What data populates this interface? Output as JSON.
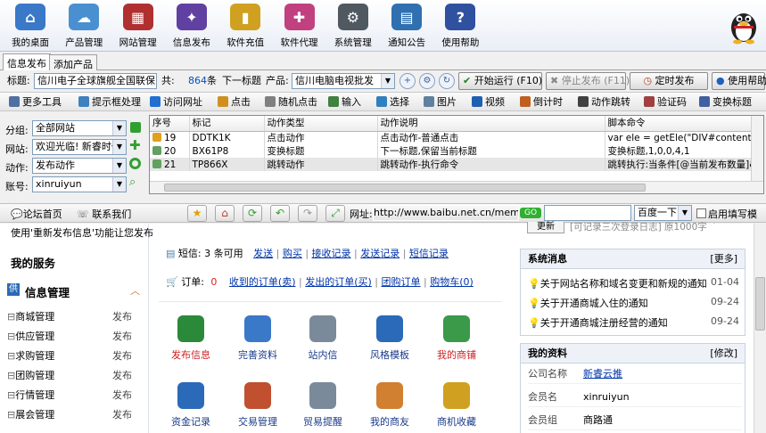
{
  "toolbar": {
    "buttons": [
      {
        "label": "我的桌面",
        "icon": "home-icon",
        "color": "#3a78c8",
        "glyph": "⌂"
      },
      {
        "label": "产品管理",
        "icon": "cloud-icon",
        "color": "#4a90d0",
        "glyph": "☁"
      },
      {
        "label": "网站管理",
        "icon": "building-icon",
        "color": "#b03030",
        "glyph": "▦"
      },
      {
        "label": "信息发布",
        "icon": "magic-wand-icon",
        "color": "#6040a0",
        "glyph": "✦"
      },
      {
        "label": "软件充值",
        "icon": "chart-icon",
        "color": "#d0a020",
        "glyph": "▮"
      },
      {
        "label": "软件代理",
        "icon": "gift-icon",
        "color": "#c04080",
        "glyph": "✚"
      },
      {
        "label": "系统管理",
        "icon": "gear-icon",
        "color": "#505860",
        "glyph": "⚙"
      },
      {
        "label": "通知公告",
        "icon": "notebook-icon",
        "color": "#3070b0",
        "glyph": "▤"
      },
      {
        "label": "使用帮助",
        "icon": "help-icon",
        "color": "#3050a0",
        "glyph": "?"
      }
    ]
  },
  "tabs": [
    "信息发布",
    "添加产品"
  ],
  "title_row": {
    "title_label": "标题:",
    "title_value": "信川电子全球旗舰全国联保",
    "total_label": "共:",
    "total_count": "864",
    "total_unit": "条",
    "next_title": "下一标题",
    "product_label": "产品:",
    "product_value": "信川电脑电视批发",
    "start_button": "开始运行 (F10)",
    "stop_button": "停止发布 (F11)",
    "timer_button": "定时发布",
    "help_button": "使用帮助"
  },
  "tool2": [
    {
      "label": "更多工具",
      "icon": "tools-icon",
      "color": "#5070a0"
    },
    {
      "label": "提示框处理",
      "icon": "dialog-icon",
      "color": "#4080c0"
    },
    {
      "label": "访问网址",
      "icon": "ie-icon",
      "color": "#2070d0"
    },
    {
      "label": "点击",
      "icon": "pointer-icon",
      "color": "#d09020"
    },
    {
      "label": "随机点击",
      "icon": "random-click-icon",
      "color": "#808080"
    },
    {
      "label": "输入",
      "icon": "keyboard-icon",
      "color": "#408040"
    },
    {
      "label": "选择",
      "icon": "checkbox-icon",
      "color": "#3080c0"
    },
    {
      "label": "图片",
      "icon": "image-icon",
      "color": "#6080a0"
    },
    {
      "label": "视频",
      "icon": "video-icon",
      "color": "#2060b0"
    },
    {
      "label": "倒计时",
      "icon": "clock-icon",
      "color": "#c06020"
    },
    {
      "label": "动作跳转",
      "icon": "jump-icon",
      "color": "#404040"
    },
    {
      "label": "验证码",
      "icon": "captcha-icon",
      "color": "#a04040"
    },
    {
      "label": "变换标题",
      "icon": "transform-icon",
      "color": "#4060a0"
    }
  ],
  "left_fields": {
    "group_label": "分组:",
    "group_value": "全部网站",
    "site_label": "网站:",
    "site_value": "欢迎光临! 新睿时代",
    "action_label": "动作:",
    "action_value": "发布动作",
    "account_label": "账号:",
    "account_value": "xinruiyun"
  },
  "grid": {
    "headers": [
      "序号",
      "标记",
      "动作类型",
      "动作说明",
      "脚本命令"
    ],
    "rows": [
      [
        "19",
        "DDTK1K",
        "点击动作",
        "点击动作-普通点击",
        "var ele = getEle(\"DIV#contentmb"
      ],
      [
        "20",
        "BX61P8",
        "变换标题",
        "下一标题,保留当前标题",
        "变换标题,1,0,0,4,1"
      ],
      [
        "21",
        "TP866X",
        "跳转动作",
        "跳转动作-执行命令",
        "跳转执行:当条件[@当前发布数量]&"
      ]
    ]
  },
  "browser": {
    "forum_link": "论坛首页",
    "contact_link": "联系我们",
    "url_label": "网址:",
    "url_value": "http://www.baibu.net.cn/membe",
    "go_label": "GO",
    "search_engine": "百度一下",
    "checkbox_label": "启用填写模式"
  },
  "web": {
    "left": {
      "notice": "使用'重新发布信息'功能让您发布",
      "my_service": "我的服务",
      "info_mgmt": "信息管理",
      "items": [
        "商城管理",
        "供应管理",
        "求购管理",
        "团购管理",
        "行情管理",
        "展会管理"
      ],
      "publish": "发布"
    },
    "center": {
      "sms_label": "短信:",
      "sms_count": "3 条可用",
      "sms_links": [
        "发送",
        "购买",
        "接收记录",
        "发送记录",
        "短信记录"
      ],
      "order_label": "订单:",
      "order_count": "0",
      "order_links": [
        "收到的订单(卖)",
        "发出的订单(买)",
        "团购订单",
        "购物车(0)"
      ],
      "icons": [
        {
          "label": "发布信息",
          "icon": "publish-info-icon",
          "color": "#2a8a3a",
          "red": true
        },
        {
          "label": "完善资料",
          "icon": "edit-profile-icon",
          "color": "#3a78c8",
          "red": false
        },
        {
          "label": "站内信",
          "icon": "mail-icon",
          "color": "#7a8a9a",
          "red": false
        },
        {
          "label": "风格模板",
          "icon": "template-icon",
          "color": "#2a6ab8",
          "red": false
        },
        {
          "label": "我的商铺",
          "icon": "shop-icon",
          "color": "#3a9a4a",
          "red": true
        },
        {
          "label": "资金记录",
          "icon": "money-record-icon",
          "color": "#2a6ab8",
          "red": false
        },
        {
          "label": "交易管理",
          "icon": "trade-icon",
          "color": "#c05030",
          "red": false
        },
        {
          "label": "贸易提醒",
          "icon": "reminder-icon",
          "color": "#7a8a9a",
          "red": false
        },
        {
          "label": "我的商友",
          "icon": "friends-icon",
          "color": "#d08030",
          "red": false
        },
        {
          "label": "商机收藏",
          "icon": "favorites-icon",
          "color": "#d0a020",
          "red": false
        }
      ]
    },
    "right": {
      "top_text": "[可记录三次登录日志] 原1000字",
      "top_button": "更新",
      "sys_title": "系统消息",
      "more": "[更多]",
      "news": [
        {
          "text": "关于网站名称和域名变更和新规的通知",
          "date": "01-04"
        },
        {
          "text": "关于开通商城入住的通知",
          "date": "09-24"
        },
        {
          "text": "关于开通商城注册经营的通知",
          "date": "09-24"
        }
      ],
      "profile_title": "我的资料",
      "edit": "[修改]",
      "company_label": "公司名称",
      "company_value": "新睿云推",
      "member_label": "会员名",
      "member_value": "xinruiyun",
      "group_label": "会员组",
      "group_value": "商路通"
    }
  }
}
